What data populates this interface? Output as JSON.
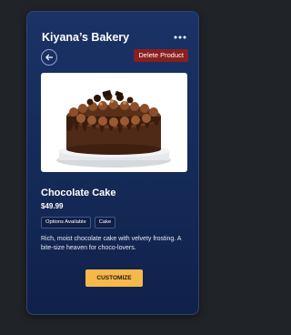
{
  "app": {
    "title": "Kiyana’s Bakery"
  },
  "toolbar": {
    "delete_label": "Delete Product"
  },
  "product": {
    "name": "Chocolate Cake",
    "price": "$49.99",
    "tags": [
      "Options Available",
      "Cake"
    ],
    "description": "Rich, moist chocolate cake with velvety frosting. A bite-size heaven for choco-lovers.",
    "image_icon": "chocolate-cake-image"
  },
  "actions": {
    "customize_label": "CUSTOMIZE"
  },
  "colors": {
    "background": "#202327",
    "card": "#1a3266",
    "delete": "#8a1f1f",
    "accent": "#f5b84a"
  }
}
